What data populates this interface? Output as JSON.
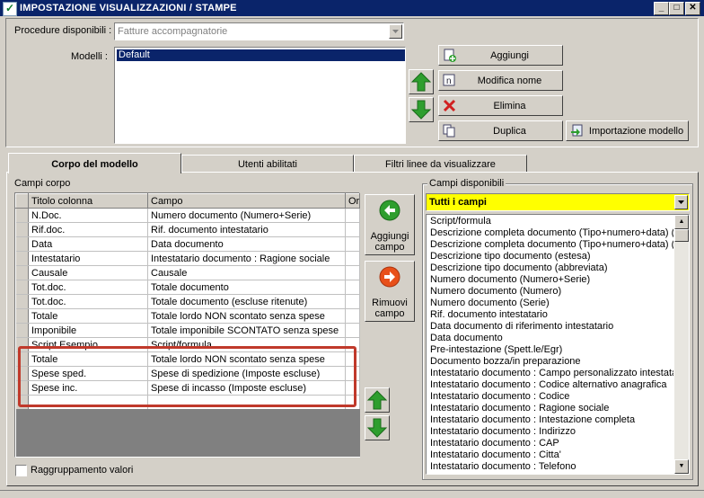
{
  "window": {
    "title": "IMPOSTAZIONE VISUALIZZAZIONI / STAMPE"
  },
  "header": {
    "procedure_label": "Procedure disponibili :",
    "procedure_value": "Fatture accompagnatorie",
    "models_label": "Modelli :",
    "models": [
      "Default"
    ]
  },
  "buttons": {
    "aggiungi": "Aggiungi",
    "modifica_nome": "Modifica nome",
    "elimina": "Elimina",
    "duplica": "Duplica",
    "importazione": "Importazione modello",
    "aggiungi_campo_1": "Aggiungi",
    "aggiungi_campo_2": "campo",
    "rimuovi_campo_1": "Rimuovi",
    "rimuovi_campo_2": "campo"
  },
  "tabs": [
    {
      "label": "Corpo del modello",
      "active": true
    },
    {
      "label": "Utenti abilitati",
      "active": false
    },
    {
      "label": "Filtri linee da visualizzare",
      "active": false
    }
  ],
  "campi_corpo": {
    "label": "Campi corpo",
    "columns": [
      "Titolo colonna",
      "Campo",
      "Ord"
    ],
    "rows": [
      [
        "N.Doc.",
        "Numero documento (Numero+Serie)"
      ],
      [
        "Rif.doc.",
        "Rif. documento intestatario"
      ],
      [
        "Data",
        "Data documento"
      ],
      [
        "Intestatario",
        "Intestatario documento : Ragione sociale"
      ],
      [
        "Causale",
        "Causale"
      ],
      [
        "Tot.doc.",
        "Totale documento"
      ],
      [
        "Tot.doc.",
        "Totale documento (escluse ritenute)"
      ],
      [
        "Totale",
        "Totale lordo NON scontato senza spese"
      ],
      [
        "Imponibile",
        "Totale imponibile SCONTATO senza spese"
      ],
      [
        "Script Esempio",
        "Script/formula"
      ],
      [
        "Totale",
        "Totale lordo NON scontato senza spese"
      ],
      [
        "Spese sped.",
        "Spese di spedizione (Imposte escluse)"
      ],
      [
        "Spese inc.",
        "Spese di incasso (Imposte escluse)"
      ]
    ],
    "raggruppamento_label": "Raggruppamento valori"
  },
  "campi_disponibili": {
    "label": "Campi disponibili",
    "filter_value": "Tutti i campi",
    "items": [
      "Script/formula",
      "Descrizione completa documento (Tipo+numero+data) (estesa)",
      "Descrizione completa documento (Tipo+numero+data) (abbreviata)",
      "Descrizione tipo documento (estesa)",
      "Descrizione tipo documento (abbreviata)",
      "Numero documento (Numero+Serie)",
      "Numero documento (Numero)",
      "Numero documento (Serie)",
      "Rif. documento intestatario",
      "Data documento di riferimento intestatario",
      "Data documento",
      "Pre-intestazione (Spett.le/Egr)",
      "Documento bozza/in preparazione",
      "Intestatario documento : Campo personalizzato intestatario",
      "Intestatario documento : Codice alternativo anagrafica",
      "Intestatario documento : Codice",
      "Intestatario documento : Ragione sociale",
      "Intestatario documento : Intestazione completa",
      "Intestatario documento : Indirizzo",
      "Intestatario documento : CAP",
      "Intestatario documento : Citta'",
      "Intestatario documento : Telefono"
    ]
  },
  "colors": {
    "titlebar": "#0a246a",
    "selection": "#0a246a",
    "highlight_box": "#c0392b",
    "filter_bg": "#ffff00",
    "arrow_green": "#2e9e2e",
    "remove_orange": "#e8501a"
  }
}
